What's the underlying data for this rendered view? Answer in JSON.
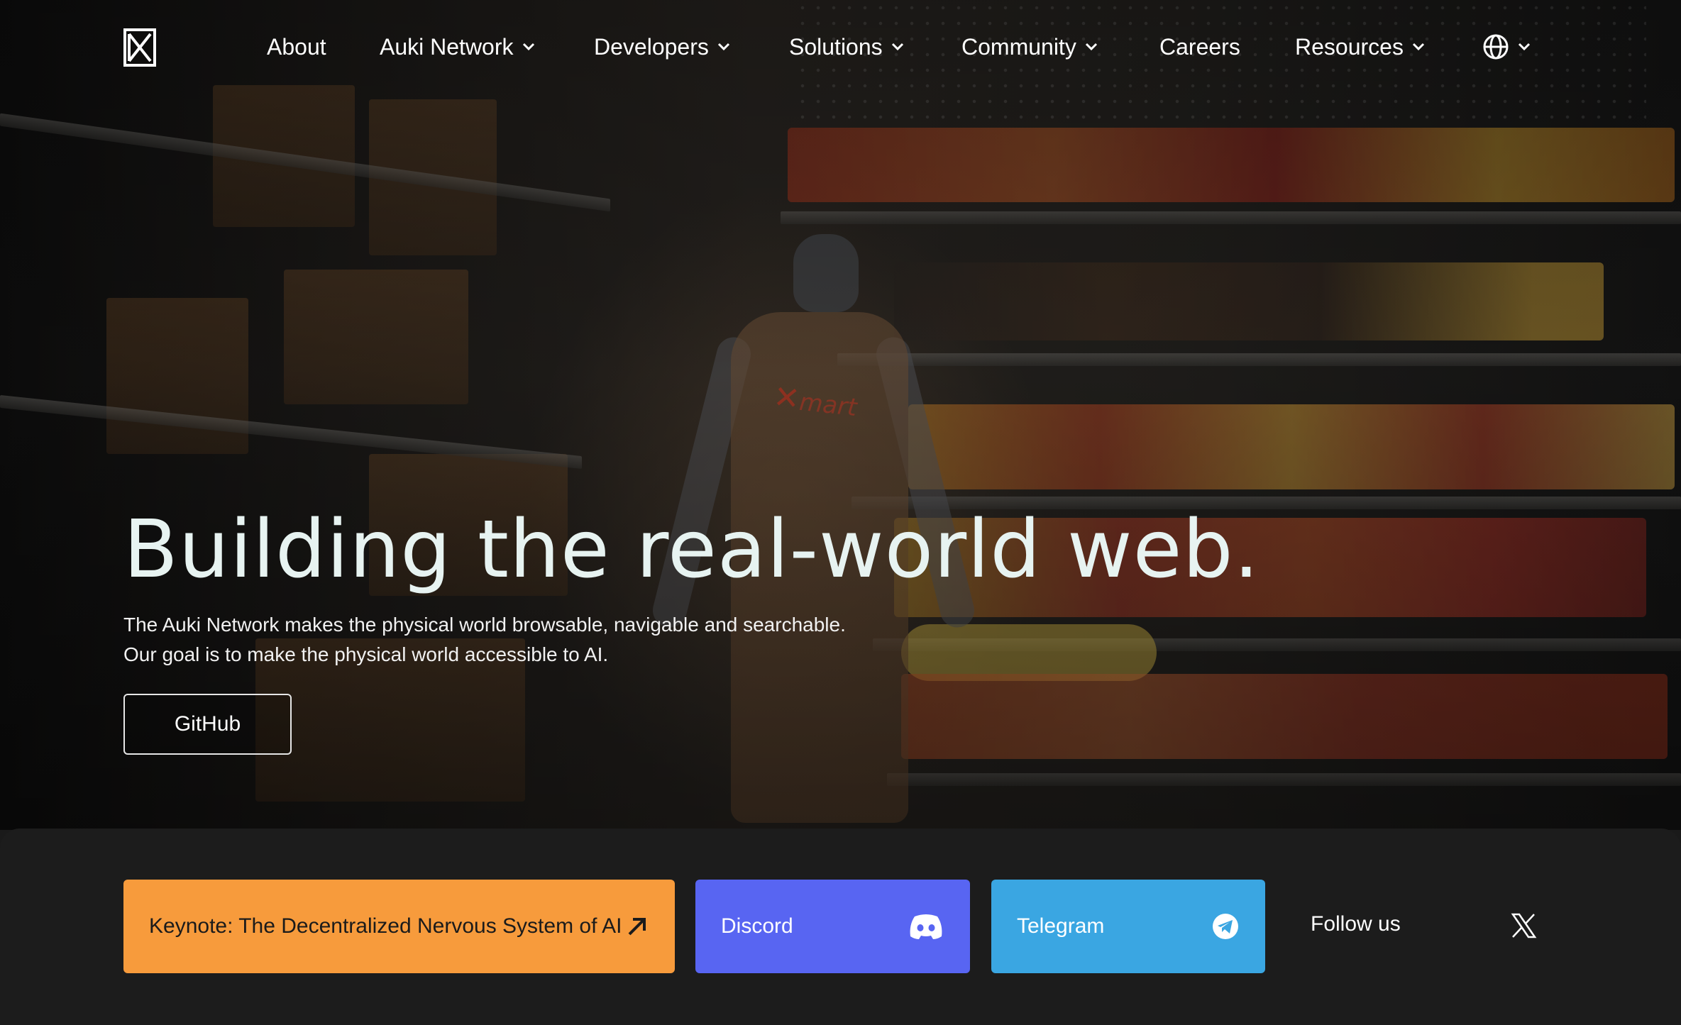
{
  "nav": {
    "items": [
      {
        "label": "About",
        "has_dropdown": false
      },
      {
        "label": "Auki Network",
        "has_dropdown": true
      },
      {
        "label": "Developers",
        "has_dropdown": true
      },
      {
        "label": "Solutions",
        "has_dropdown": true
      },
      {
        "label": "Community",
        "has_dropdown": true
      },
      {
        "label": "Careers",
        "has_dropdown": false
      },
      {
        "label": "Resources",
        "has_dropdown": true
      }
    ],
    "language_icon": "globe-icon"
  },
  "hero": {
    "title": "Building the real-world web.",
    "subtitle_line1": "The Auki Network makes the physical world browsable, navigable and searchable.",
    "subtitle_line2": "Our goal is to make the physical world accessible to AI.",
    "cta_label": "GitHub",
    "apron_text": "mart"
  },
  "links": {
    "keynote_label": "Keynote: The Decentralized Nervous System of AI",
    "discord_label": "Discord",
    "telegram_label": "Telegram",
    "follow_label": "Follow us"
  },
  "colors": {
    "keynote": "#f79b3c",
    "discord": "#5865f2",
    "telegram": "#3aa6e2",
    "title": "#e7f3f1",
    "panel": "#1c1c1c"
  }
}
